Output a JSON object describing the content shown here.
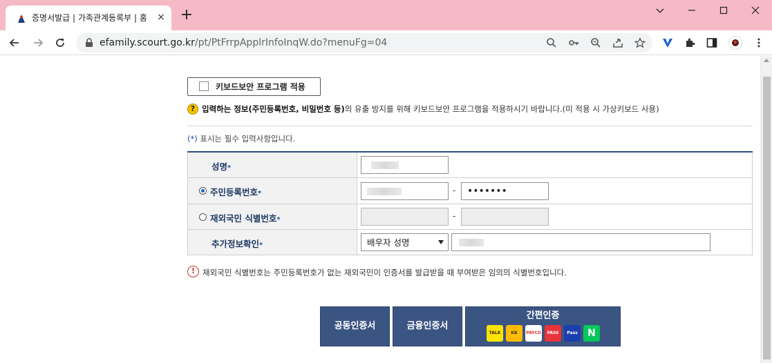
{
  "browser": {
    "tab_title": "증명서발급 | 가족관계등록부 | 홈",
    "tab_close": "×",
    "new_tab": "+",
    "url_host": "efamily.scourt.go.kr",
    "url_path": "/pt/PtFrrpApplrInfoInqW.do?menuFg=04",
    "window_controls": [
      "minimize",
      "maximize",
      "close"
    ]
  },
  "page": {
    "keyboard_security_label": "키보드보안 프로그램 적용",
    "notice_bold": "입력하는 정보(주민등록번호, 비밀번호 등)",
    "notice_rest": "의 유출 방지를 위해 키보드보안 프로그램을 적용하시기 바랍니다.(미 적용 시 가상키보드 사용)",
    "required_note_star": "(*)",
    "required_note_text": " 표시는 필수 입력사항입니다.",
    "form": {
      "name_label": "성명",
      "resident_label": "주민등록번호",
      "foreigner_label": "재외국민 식별번호",
      "extra_label": "추가정보확인",
      "star": "*",
      "dash": "-",
      "resident_back_masked": "•••••••",
      "extra_select_value": "배우자 성명",
      "resident_selected": true
    },
    "warning_text": "재외국민 식별번호는 주민등록번호가 없는 재외국민이 인증서를 발급받을 때 부여받은 임의의 식별번호입니다.",
    "auth": {
      "joint_cert": "공동인증서",
      "financial_cert": "금융인증서",
      "simple_auth": "간편인증",
      "providers": [
        {
          "name": "TALK",
          "bg": "#fee500",
          "fg": "#3a1d1d"
        },
        {
          "name": "KB",
          "bg": "#ffbc00",
          "fg": "#3b3127"
        },
        {
          "name": "PAYCO",
          "bg": "#ffffff",
          "fg": "#e63329"
        },
        {
          "name": "PASS",
          "bg": "#e8343a",
          "fg": "#ffffff"
        },
        {
          "name": "Pass",
          "bg": "#1b3fae",
          "fg": "#ffffff"
        },
        {
          "name": "N",
          "bg": "#03c75a",
          "fg": "#ffffff"
        }
      ]
    }
  },
  "colors": {
    "tabbar": "#f6b9c6",
    "table_top_border": "#2a4f7e",
    "label_text": "#1f3a66",
    "auth_button": "#3b5583"
  }
}
